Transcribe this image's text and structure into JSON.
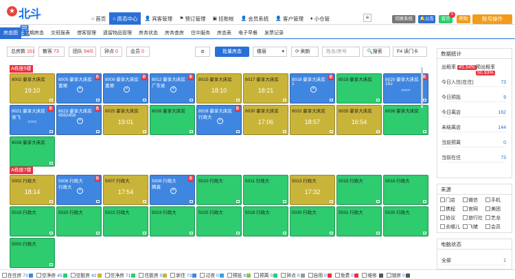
{
  "header": {
    "logo_text": "北斗星",
    "nav": [
      {
        "label": "首页",
        "icon": "home-icon"
      },
      {
        "label": "房态中心",
        "icon": "home-icon",
        "active": true
      },
      {
        "label": "宾客管理",
        "icon": "user-icon"
      },
      {
        "label": "预订管理",
        "icon": "bookmark-icon"
      },
      {
        "label": "挂账帐",
        "icon": "wallet-icon"
      },
      {
        "label": "会员系统",
        "icon": "user-icon"
      },
      {
        "label": "客户管理",
        "icon": "user-icon"
      },
      {
        "label": "小仓管",
        "icon": "cart-icon"
      }
    ],
    "buttons": {
      "switch_system": "切换系统",
      "notice": "公告",
      "message": "留言",
      "message_count": "0",
      "help": "帮助",
      "account": "账号操作"
    }
  },
  "subnav": [
    "房态图",
    "远期房态",
    "交班报表",
    "借客管理",
    "遗留物品管理",
    "房务状态",
    "房务查房",
    "住中服务",
    "房态表",
    "电子早餐",
    "发票记录"
  ],
  "filter": {
    "stats": [
      {
        "label": "总房数",
        "value": "161"
      },
      {
        "label": "散客",
        "value": "73"
      },
      {
        "label": "团队",
        "value": "94/0"
      },
      {
        "label": "钟点",
        "value": "0"
      },
      {
        "label": "会员",
        "value": "0"
      }
    ],
    "batch_label": "批量房态",
    "floor_label": "楼层",
    "refresh_label": "刷新",
    "search_placeholder": "姓名/房号",
    "search_label": "搜索",
    "card_label": "F4 读门卡"
  },
  "sections": [
    {
      "title": "A栋座5楼",
      "rooms": [
        {
          "no": "8002 豪享大床房",
          "color": "yellow",
          "time": "19:10",
          "pay": true
        },
        {
          "no": "8005 豪享大床房",
          "color": "blue",
          "guest": "富顺",
          "x": true,
          "flag": "散"
        },
        {
          "no": "8009 豪享大床房",
          "color": "blue",
          "guest": "富顺",
          "x": true,
          "flag": "散"
        },
        {
          "no": "8012 豪享大床房",
          "color": "blue",
          "guest": "广东省",
          "x": true,
          "flag": "散"
        },
        {
          "no": "8015 豪享大床房",
          "color": "yellow",
          "time": "18:10"
        },
        {
          "no": "8017 豪享大床房",
          "color": "yellow",
          "time": "18:21"
        },
        {
          "no": "8018 豪享大床房",
          "color": "blue",
          "guest": "1",
          "x": true,
          "flag": "散"
        },
        {
          "no": "8019 豪享大床房",
          "color": "green"
        },
        {
          "no": "8020 豪享大床房",
          "color": "blue",
          "guest": "152",
          "pay": true,
          "flag": "散"
        },
        {
          "no": "8021 豪享大床房",
          "color": "blue",
          "guest": "张飞",
          "pay": true,
          "flag": "散"
        },
        {
          "no": "8023 豪享大床房",
          "color": "blue",
          "guest": "4562458",
          "x": true,
          "flag": "散"
        },
        {
          "no": "8025 豪享大床房",
          "color": "yellow",
          "time": "19:01"
        },
        {
          "no": "8026 豪享大床房",
          "color": "green"
        },
        {
          "no": "8028 豪享大床房",
          "color": "blue",
          "guest": "行政大",
          "x": true,
          "flag": "散"
        },
        {
          "no": "8030 豪享大床房",
          "color": "yellow",
          "time": "17:06"
        },
        {
          "no": "8032 豪享大床房",
          "color": "yellow",
          "time": "18:57"
        },
        {
          "no": "8035 豪享大床房",
          "color": "yellow",
          "time": "16:54"
        },
        {
          "no": "8038 豪享大床房",
          "color": "green"
        },
        {
          "no": "8039 豪享大床房",
          "color": "green"
        }
      ]
    },
    {
      "title": "A栋座7楼",
      "rooms": [
        {
          "no": "5002 行政大",
          "color": "yellow",
          "time": "18:14"
        },
        {
          "no": "5006 行政大",
          "color": "blue",
          "guest": "行政大",
          "x": true,
          "flag": "散"
        },
        {
          "no": "5007 行政大",
          "color": "yellow",
          "time": "17:54"
        },
        {
          "no": "5008 行政大",
          "color": "blue",
          "guest": "腾袭",
          "x": true,
          "flag": "散"
        },
        {
          "no": "5010 行政大",
          "color": "green"
        },
        {
          "no": "5011 行政大",
          "color": "green"
        },
        {
          "no": "5013 行政大",
          "color": "yellow",
          "time": "17:32"
        },
        {
          "no": "5015 行政大",
          "color": "green"
        },
        {
          "no": "5018 行政大",
          "color": "green"
        },
        {
          "no": "5019 行政大",
          "color": "green"
        },
        {
          "no": "5020 行政大",
          "color": "green"
        },
        {
          "no": "5022 行政大",
          "color": "green"
        },
        {
          "no": "5023 行政大",
          "color": "green"
        },
        {
          "no": "5025 行政大",
          "color": "green"
        },
        {
          "no": "5028 行政大",
          "color": "green"
        },
        {
          "no": "5030 行政大",
          "color": "green"
        },
        {
          "no": "5031 行政大",
          "color": "green"
        },
        {
          "no": "5035 行政大",
          "color": "green"
        },
        {
          "no": "5050 行政大",
          "color": "green"
        }
      ]
    }
  ],
  "stats_panel": {
    "title": "数据统计",
    "rent_rate_label": "出租率",
    "rent_rate": "45.34%",
    "prebook_rate_label": "预出租率",
    "prebook_rate": "50.93%",
    "rows": [
      {
        "label": "今日入住(在住)",
        "value": "73"
      },
      {
        "label": "今日预抵",
        "value": "9"
      },
      {
        "label": "今日离店",
        "value": "162"
      },
      {
        "label": "未结离店",
        "value": "144"
      },
      {
        "label": "当前预离",
        "value": "0"
      },
      {
        "label": "当前在住",
        "value": "73"
      }
    ]
  },
  "source_panel": {
    "title": "来源",
    "items": [
      "门店",
      "微信",
      "手机",
      "携程",
      "官网",
      "美团",
      "协议",
      "旅行社",
      "艺龙",
      "去哪儿",
      "飞猪",
      "会员"
    ]
  },
  "power_panel": {
    "title": "电脑状态",
    "all_label": "全部",
    "all_value": "1"
  },
  "legend": [
    {
      "label": "在住房",
      "value": "73",
      "color": "#3f86e0"
    },
    {
      "label": "空净房",
      "value": "45",
      "color": "#2ecb6f"
    },
    {
      "label": "空脏房",
      "value": "42",
      "color": "#c9b43a"
    },
    {
      "label": "住净房",
      "value": "71",
      "color": "#2ecb6f"
    },
    {
      "label": "住脏房",
      "value": "0",
      "color": "#c9b43a"
    },
    {
      "label": "新住",
      "value": "73",
      "color": "#3f86e0"
    },
    {
      "label": "过夜",
      "value": "0",
      "color": "#3fa0e0"
    },
    {
      "label": "预抵",
      "value": "9",
      "color": "#8bc34a"
    },
    {
      "label": "预离",
      "value": "0",
      "color": "#2ecb6f"
    },
    {
      "label": "钟点",
      "value": "0",
      "color": "#999999"
    },
    {
      "label": "自用",
      "value": "0",
      "color": "#e8303a"
    },
    {
      "label": "免费",
      "value": "0",
      "color": "#e8303a"
    },
    {
      "label": "维修",
      "value": "",
      "color": "#555555"
    },
    {
      "label": "锁房",
      "value": "0",
      "color": "#555555"
    }
  ]
}
